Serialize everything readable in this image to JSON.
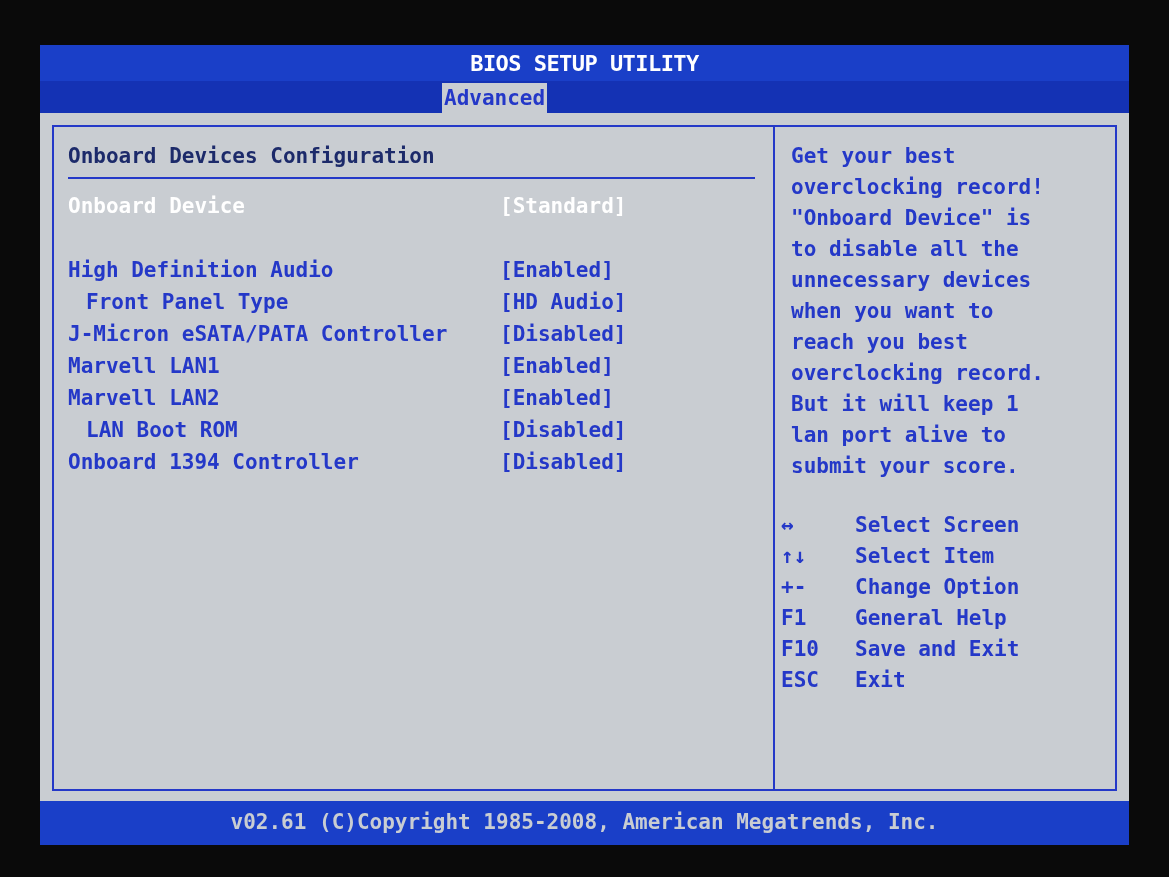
{
  "window": {
    "title": "BIOS SETUP UTILITY"
  },
  "tabs": [
    {
      "label": "Advanced",
      "selected": true
    }
  ],
  "section": {
    "title": "Onboard Devices Configuration"
  },
  "primary": {
    "label": "Onboard Device",
    "value": "[Standard]",
    "selected": true
  },
  "settings": [
    {
      "label": "High Definition Audio",
      "value": "[Enabled]",
      "selected": false,
      "children": [
        {
          "label": "Front Panel Type",
          "value": "[HD Audio]",
          "selected": false
        }
      ]
    },
    {
      "label": "J-Micron eSATA/PATA Controller",
      "value": "[Disabled]",
      "selected": false
    },
    {
      "label": "Marvell LAN1",
      "value": "[Enabled]",
      "selected": false
    },
    {
      "label": "Marvell LAN2",
      "value": "[Enabled]",
      "selected": false,
      "children": [
        {
          "label": "LAN Boot ROM",
          "value": "[Disabled]",
          "selected": false
        }
      ]
    },
    {
      "label": "Onboard 1394 Controller",
      "value": "[Disabled]",
      "selected": false
    }
  ],
  "help": {
    "text": "Get your best overclocking record! \"Onboard Device\" is to disable all the unnecessary devices when you want to reach you best overclocking record. But it will keep 1 lan port alive to submit your score."
  },
  "keys": [
    {
      "key": "↔",
      "action": "Select Screen"
    },
    {
      "key": "↑↓",
      "action": "Select Item"
    },
    {
      "key": "+-",
      "action": "Change Option"
    },
    {
      "key": "F1",
      "action": "General Help"
    },
    {
      "key": "F10",
      "action": "Save and Exit"
    },
    {
      "key": "ESC",
      "action": "Exit"
    }
  ],
  "status_bar": {
    "text": "v02.61 (C)Copyright 1985-2008, American Megatrends, Inc."
  }
}
